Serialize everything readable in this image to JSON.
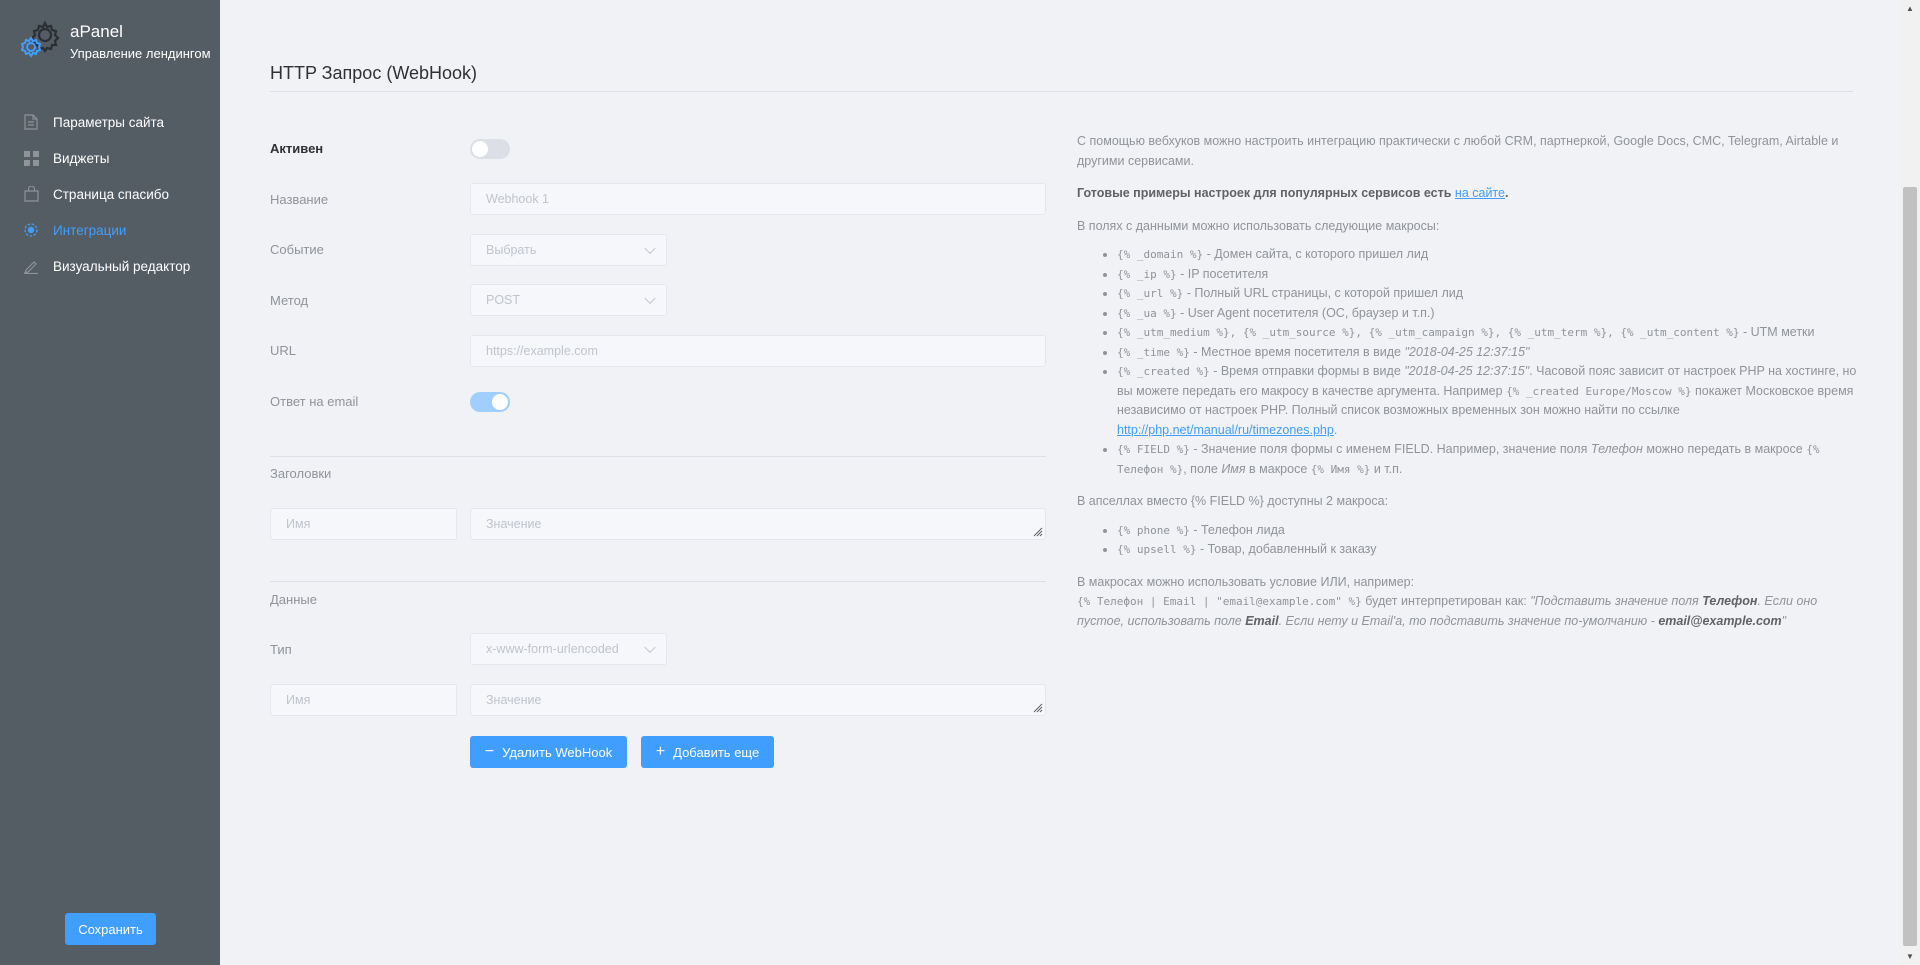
{
  "brand": {
    "title": "aPanel",
    "subtitle": "Управление лендингом",
    "logo_icon": "gear-icon"
  },
  "sidebar": {
    "items": [
      {
        "label": "Параметры сайта",
        "icon": "document-icon",
        "active": false
      },
      {
        "label": "Виджеты",
        "icon": "grid-icon",
        "active": false
      },
      {
        "label": "Страница спасибо",
        "icon": "bag-icon",
        "active": false
      },
      {
        "label": "Интеграции",
        "icon": "integrations-icon",
        "active": true
      },
      {
        "label": "Визуальный редактор",
        "icon": "edit-icon",
        "active": false
      }
    ],
    "save_label": "Сохранить"
  },
  "colors": {
    "accent": "#409eff",
    "sidebar_bg": "#545c64"
  },
  "page": {
    "title": "HTTP Запрос (WebHook)"
  },
  "form": {
    "active_label": "Активен",
    "active_on": false,
    "name_label": "Название",
    "name_placeholder": "Webhook 1",
    "event_label": "Событие",
    "event_placeholder": "Выбрать",
    "method_label": "Метод",
    "method_value": "POST",
    "url_label": "URL",
    "url_placeholder": "https://example.com",
    "email_label": "Ответ на email",
    "email_on": true,
    "headers_label": "Заголовки",
    "header_name_placeholder": "Имя",
    "header_value_placeholder": "Значение",
    "data_label": "Данные",
    "type_label": "Тип",
    "type_value": "x-www-form-urlencoded",
    "data_name_placeholder": "Имя",
    "data_value_placeholder": "Значение",
    "delete_label": "Удалить WebHook",
    "add_label": "Добавить еще"
  },
  "help": {
    "intro": "С помощью вебхуков можно настроить интеграцию практически с любой CRM, партнеркой, Google Docs, CMC, Telegram, Airtable и другими сервисами.",
    "examples_text": "Готовые примеры настроек для популярных сервисов есть",
    "examples_link": "на сайте",
    "examples_end": ".",
    "macros_intro": "В полях с данными можно использовать следующие макросы:",
    "m1_code": "{% _domain %}",
    "m1_text": " - Домен сайта, с которого пришел лид",
    "m2_code": "{% _ip %}",
    "m2_text": " - IP посетителя",
    "m3_code": "{% _url %}",
    "m3_text": " - Полный URL страницы, с которой пришел лид",
    "m4_code": "{% _ua %}",
    "m4_text": " - User Agent посетителя (ОС, браузер и т.п.)",
    "m5_code": "{% _utm_medium %}, {% _utm_source %}, {% _utm_campaign %}, {% _utm_term %}, {% _utm_content %}",
    "m5_text": " - UTM метки",
    "m6_code": "{% _time %}",
    "m6_text": " - Местное время посетителя в виде ",
    "m6_example": "\"2018-04-25 12:37:15\"",
    "m7_code": "{% _created %}",
    "m7_text1": " - Время отправки формы в виде ",
    "m7_example": "\"2018-04-25 12:37:15\"",
    "m7_text2": ". Часовой пояс зависит от настроек PHP на хостинге, но вы можете передать его макросу в качестве аргумента. Например ",
    "m7_code2": "{% _created Europe/Moscow %}",
    "m7_text3": " покажет Московское время независимо от настроек PHP. Полный список возможных временных зон можно найти по ссылке ",
    "m7_link": "http://php.net/manual/ru/timezones.php",
    "m7_end": ".",
    "m8_code": "{% FIELD %}",
    "m8_text1": " - Значение поля формы с именем FIELD. Например, значение поля ",
    "m8_i1": "Телефон",
    "m8_text2": " можно передать в макросе ",
    "m8_code2": "{% Телефон %}",
    "m8_text3": ", поле ",
    "m8_i2": "Имя",
    "m8_text4": " в макросе ",
    "m8_code3": "{% Имя %}",
    "m8_text5": " и т.п.",
    "upsell_intro": "В апселлах вместо {% FIELD %} доступны 2 макроса:",
    "u1_code": "{% phone %}",
    "u1_text": " - Телефон лида",
    "u2_code": "{% upsell %}",
    "u2_text": " - Товар, добавленный к заказу",
    "or_intro": "В макросах можно использовать условие ИЛИ, например:",
    "or_code": "{% Телефон | Email | \"email@example.com\" %}",
    "or_text": " будет интерпретирован как: ",
    "or_i1": "\"Подставить значение поля ",
    "or_b1": "Телефон",
    "or_i2": ". Если оно пустое, использовать поле ",
    "or_b2": "Email",
    "or_i3": ". Если нету и Email'a, то подставить значение по-умолчанию - ",
    "or_b3": "email@example.com",
    "or_i4": "\""
  }
}
